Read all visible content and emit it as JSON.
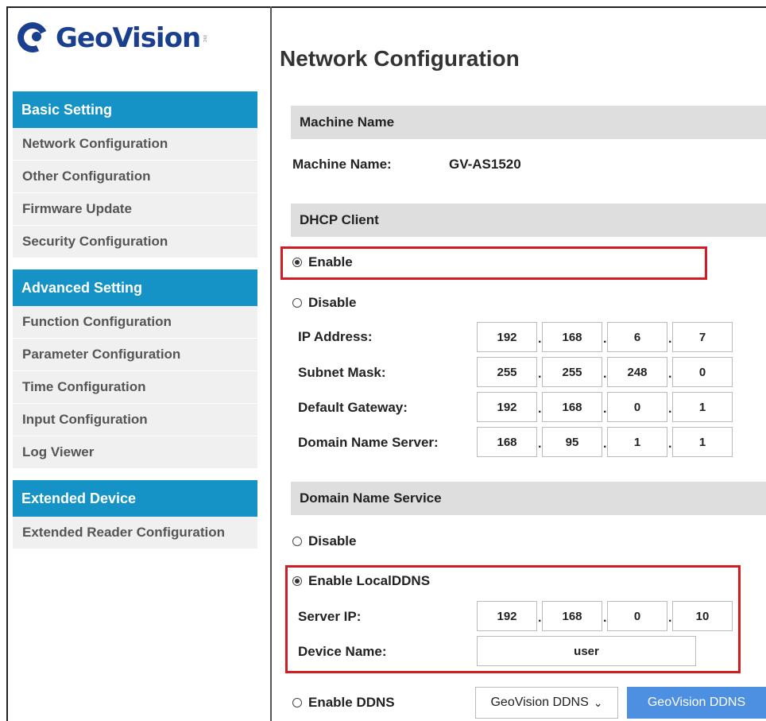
{
  "brand": {
    "name": "GeoVision",
    "inc": "inc"
  },
  "sidebar": {
    "sections": [
      {
        "title": "Basic Setting",
        "items": [
          "Network Configuration",
          "Other Configuration",
          "Firmware Update",
          "Security Configuration"
        ]
      },
      {
        "title": "Advanced Setting",
        "items": [
          "Function Configuration",
          "Parameter Configuration",
          "Time Configuration",
          "Input Configuration",
          "Log Viewer"
        ]
      },
      {
        "title": "Extended Device",
        "items": [
          "Extended Reader Configuration"
        ]
      }
    ]
  },
  "main": {
    "title": "Network Configuration",
    "machine": {
      "section": "Machine Name",
      "label": "Machine Name:",
      "value": "GV-AS1520"
    },
    "dhcp": {
      "section": "DHCP Client",
      "enable": "Enable",
      "disable": "Disable",
      "selected": "enable",
      "fields": [
        {
          "label": "IP Address:",
          "octets": [
            "192",
            "168",
            "6",
            "7"
          ]
        },
        {
          "label": "Subnet Mask:",
          "octets": [
            "255",
            "255",
            "248",
            "0"
          ]
        },
        {
          "label": "Default Gateway:",
          "octets": [
            "192",
            "168",
            "0",
            "1"
          ]
        },
        {
          "label": "Domain Name Server:",
          "octets": [
            "168",
            "95",
            "1",
            "1"
          ]
        }
      ]
    },
    "dns": {
      "section": "Domain Name Service",
      "disable": "Disable",
      "local": "Enable LocalDDNS",
      "selected": "local",
      "server_ip_label": "Server IP:",
      "server_ip": [
        "192",
        "168",
        "0",
        "10"
      ],
      "device_name_label": "Device Name:",
      "device_name": "user",
      "ddns": "Enable DDNS",
      "ddns_provider": "GeoVision DDNS",
      "ddns_button": "GeoVision DDNS"
    }
  },
  "colors": {
    "accent": "#1593c6",
    "highlight": "#d11c24",
    "button": "#4d8fe0"
  }
}
